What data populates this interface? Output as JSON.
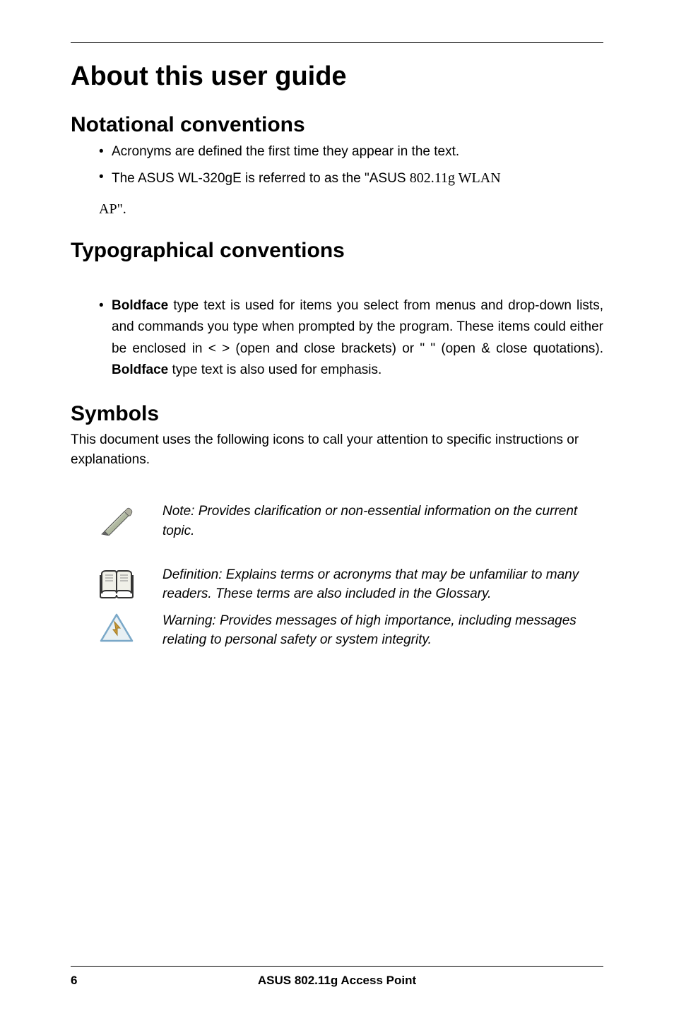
{
  "title": "About this user guide",
  "sections": {
    "notational": {
      "heading": "Notational conventions",
      "items": [
        "Acronyms are defined the first time they appear in the text.",
        "The ASUS WL-320gE is referred to as the \"ASUS 802.11g WLAN AP\"."
      ],
      "item2_prefix": "The ASUS WL-320gE is referred to as the \"ASUS ",
      "item2_serif": "802.11g WLAN AP\".",
      "item2_serif_line1": "802.11g WLAN",
      "item2_serif_line2": "AP\"."
    },
    "typographical": {
      "heading": "Typographical conventions",
      "bold1": "Boldface",
      "text1": " type text is used for items you select from menus and drop-down lists, and commands you type when prompted by the program. These items could either be enclosed in < > (open and close brackets) or \" \" (open & close quotations). ",
      "bold2": "Boldface",
      "text2": " type text is also used for emphasis."
    },
    "symbols": {
      "heading": "Symbols",
      "desc": "This document uses the following icons to call your attention to specific instructions or explanations.",
      "note": "Note: Provides clarification or non-essential information on the current topic.",
      "definition": "Definition: Explains terms or acronyms that may be unfamiliar to many readers. These terms are also included in the Glossary.",
      "warning": "Warning: Provides messages of high importance, including messages relating to personal safety or system integrity."
    }
  },
  "footer": {
    "page": "6",
    "title": "ASUS 802.11g Access Point"
  }
}
